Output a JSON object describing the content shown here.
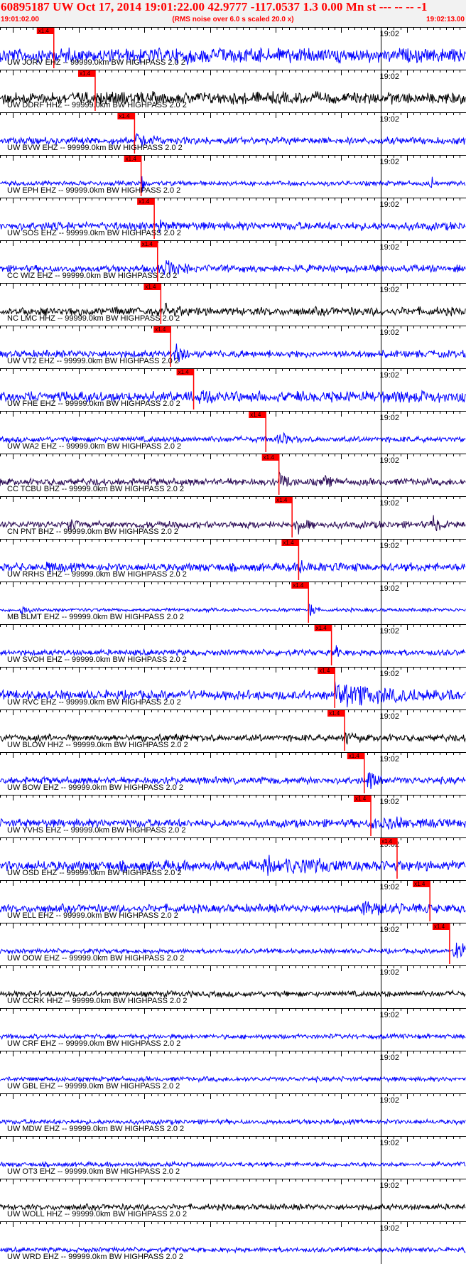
{
  "header": {
    "title": "60895187 UW Oct 17, 2014 19:01:22.00   42.9777 -117.0537  1.3 0.00 Mn st --- -- --   -1",
    "start_time": "19:01:02.00",
    "end_time": "19:02:13.00",
    "subtitle": "(RMS noise over 6.0 s scaled 20.0 x)"
  },
  "colors": {
    "trace_blue": "#0000ff",
    "trace_black": "#000000",
    "trace_purple": "#2a0a55",
    "pick_red": "#ff0000",
    "header_red": "#ff0000",
    "header_bg": "#f2f2f2"
  },
  "chart_data": {
    "type": "line",
    "title": "60895187 UW Oct 17, 2014 19:01:22.00   42.9777 -117.0537  1.3 0.00 Mn st --- -- --   -1",
    "xlim": [
      "19:01:02.00",
      "19:02:13.00"
    ],
    "x_tick_label": "19:02",
    "pick_label": "x1.4",
    "traces": [
      {
        "label": "UW JORV EHZ -- 99999.0km BW  HIGHPASS  2.0  2",
        "color": "#0000ff",
        "pick_s": 8.2,
        "amp": 12,
        "burst": [
          [
            28,
            58,
            0.6
          ],
          [
            70,
            72,
            0.7
          ]
        ]
      },
      {
        "label": "UW DDRF HHZ -- 99999.0km BW  HIGHPASS  2.0  2",
        "color": "#000000",
        "pick_s": 14.5,
        "amp": 10,
        "burst": [
          [
            15,
            22,
            0.5
          ]
        ]
      },
      {
        "label": "UW BVW EHZ -- 99999.0km BW  HIGHPASS  2.0  2",
        "color": "#0000ff",
        "pick_s": 20.5,
        "amp": 6,
        "burst": [
          [
            20.5,
            24,
            1.0
          ]
        ]
      },
      {
        "label": "UW EPH EHZ -- 99999.0km BW  HIGHPASS  2.0  2",
        "color": "#0000ff",
        "pick_s": 21.5,
        "amp": 4,
        "burst": [
          [
            21.5,
            22.5,
            1.0
          ],
          [
            65.5,
            66,
            1.0
          ]
        ]
      },
      {
        "label": "UW SOS EHZ -- 99999.0km BW  HIGHPASS  2.0  2",
        "color": "#0000ff",
        "pick_s": 23.5,
        "amp": 7,
        "burst": [
          [
            24,
            27,
            0.6
          ]
        ]
      },
      {
        "label": "CC WIZ EHZ -- 99999.0km BW  HIGHPASS  2.0  2",
        "color": "#0000ff",
        "pick_s": 24.0,
        "amp": 6,
        "burst": [
          [
            25,
            29,
            0.9
          ]
        ]
      },
      {
        "label": "NC LMC HHZ -- 99999.0km BW  HIGHPASS  2.0  2",
        "color": "#000000",
        "pick_s": 24.5,
        "amp": 7,
        "burst": [
          [
            25,
            35,
            0.6
          ]
        ]
      },
      {
        "label": "UW VT2 EHZ -- 99999.0km BW  HIGHPASS  2.0  2",
        "color": "#0000ff",
        "pick_s": 26.0,
        "amp": 6,
        "burst": [
          [
            26.5,
            29,
            1.0
          ]
        ]
      },
      {
        "label": "UW FHE EHZ -- 99999.0km BW  HIGHPASS  2.0  2",
        "color": "#0000ff",
        "pick_s": 29.5,
        "amp": 9,
        "burst": [
          [
            30,
            34,
            0.9
          ],
          [
            60,
            72,
            0.6
          ]
        ]
      },
      {
        "label": "UW WA2 EHZ -- 99999.0km BW  HIGHPASS  2.0  2",
        "color": "#0000ff",
        "pick_s": 40.5,
        "amp": 5,
        "burst": [
          [
            42,
            46,
            0.6
          ]
        ]
      },
      {
        "label": "CC TCBU BHZ -- 99999.0km BW  HIGHPASS  2.0  2",
        "color": "#2a0a55",
        "pick_s": 42.5,
        "amp": 6,
        "burst": [
          [
            42.5,
            45,
            1.0
          ],
          [
            49,
            52,
            0.6
          ]
        ]
      },
      {
        "label": "CN PNT BHZ -- 99999.0km BW  HIGHPASS  2.0  2",
        "color": "#2a0a55",
        "pick_s": 44.5,
        "amp": 6,
        "burst": [
          [
            10,
            13,
            0.6
          ],
          [
            45,
            48,
            0.8
          ],
          [
            66,
            68,
            0.7
          ]
        ]
      },
      {
        "label": "UW RRHS EHZ -- 99999.0km BW  HIGHPASS  2.0  2",
        "color": "#0000ff",
        "pick_s": 45.5,
        "amp": 7,
        "burst": [
          [
            7,
            10,
            0.6
          ],
          [
            45.5,
            60,
            0.5
          ]
        ]
      },
      {
        "label": "MB BLMT EHZ -- 99999.0km BW  HIGHPASS  2.0  2",
        "color": "#0000ff",
        "pick_s": 47.0,
        "amp": 3,
        "burst": [
          [
            3,
            5,
            0.5
          ],
          [
            47,
            48.5,
            0.8
          ]
        ]
      },
      {
        "label": "UW SVOH EHZ -- 99999.0km BW  HIGHPASS  2.0  2",
        "color": "#0000ff",
        "pick_s": 50.5,
        "amp": 5,
        "burst": [
          [
            51,
            52,
            0.9
          ]
        ]
      },
      {
        "label": "UW RVC EHZ -- 99999.0km BW  HIGHPASS  2.0  2",
        "color": "#0000ff",
        "pick_s": 51.0,
        "amp": 8,
        "burst": [
          [
            51,
            72,
            0.9
          ]
        ]
      },
      {
        "label": "UW BLOW HHZ -- 99999.0km BW  HIGHPASS  2.0  2",
        "color": "#000000",
        "pick_s": 52.5,
        "amp": 6,
        "burst": [
          [
            52.5,
            55,
            0.8
          ]
        ]
      },
      {
        "label": "UW BOW EHZ -- 99999.0km BW  HIGHPASS  2.0  2",
        "color": "#0000ff",
        "pick_s": 55.5,
        "amp": 6,
        "burst": [
          [
            56,
            59,
            0.8
          ]
        ]
      },
      {
        "label": "UW YVHS EHZ -- 99999.0km BW  HIGHPASS  2.0  2",
        "color": "#0000ff",
        "pick_s": 56.5,
        "amp": 7,
        "burst": [
          [
            56.5,
            72,
            0.6
          ]
        ]
      },
      {
        "label": "UW OSD EHZ -- 99999.0km BW  HIGHPASS  2.0  2",
        "color": "#0000ff",
        "pick_s": 60.5,
        "amp": 9,
        "burst": [
          [
            40,
            72,
            0.7
          ]
        ]
      },
      {
        "label": "UW ELL EHZ -- 99999.0km BW  HIGHPASS  2.0  2",
        "color": "#0000ff",
        "pick_s": 65.5,
        "amp": 7,
        "burst": [
          [
            55,
            72,
            0.6
          ]
        ]
      },
      {
        "label": "UW OOW EHZ -- 99999.0km BW  HIGHPASS  2.0  2",
        "color": "#0000ff",
        "pick_s": 68.5,
        "amp": 4,
        "burst": [
          [
            69,
            72,
            1.0
          ]
        ]
      },
      {
        "label": "UW CCRK HHZ -- 99999.0km BW  HIGHPASS  2.0  2",
        "color": "#000000",
        "pick_s": null,
        "amp": 5,
        "burst": []
      },
      {
        "label": "UW CRF EHZ -- 99999.0km BW  HIGHPASS  2.0  2",
        "color": "#0000ff",
        "pick_s": null,
        "amp": 4,
        "burst": []
      },
      {
        "label": "UW GBL EHZ -- 99999.0km BW  HIGHPASS  2.0  2",
        "color": "#0000ff",
        "pick_s": null,
        "amp": 4,
        "burst": []
      },
      {
        "label": "UW MDW EHZ -- 99999.0km BW  HIGHPASS  2.0  2",
        "color": "#0000ff",
        "pick_s": null,
        "amp": 4,
        "burst": []
      },
      {
        "label": "UW OT3 EHZ -- 99999.0km BW  HIGHPASS  2.0  2",
        "color": "#0000ff",
        "pick_s": null,
        "amp": 4,
        "burst": []
      },
      {
        "label": "UW WOLL HHZ -- 99999.0km BW  HIGHPASS  2.0  2",
        "color": "#000000",
        "pick_s": null,
        "amp": 5,
        "burst": []
      },
      {
        "label": "UW WRD EHZ -- 99999.0km BW  HIGHPASS  2.0  2",
        "color": "#0000ff",
        "pick_s": null,
        "amp": 4,
        "burst": []
      }
    ]
  }
}
